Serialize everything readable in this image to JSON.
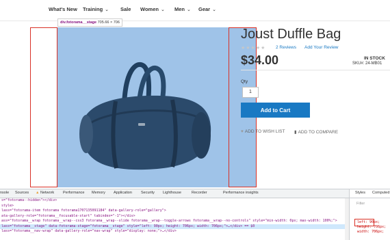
{
  "nav": {
    "items": [
      {
        "label": "What's New",
        "has_dropdown": false
      },
      {
        "label": "Training",
        "has_dropdown": true
      },
      {
        "label": "Sale",
        "has_dropdown": false
      },
      {
        "label": "Women",
        "has_dropdown": true
      },
      {
        "label": "Men",
        "has_dropdown": true
      },
      {
        "label": "Gear",
        "has_dropdown": true
      }
    ],
    "dropdown_glyph": "⌄"
  },
  "tooltip": {
    "selector": "div.fotorama__stage",
    "size": "705.66 × 706"
  },
  "product": {
    "title": "Joust Duffle Bag",
    "rating_stars": "★★★★★",
    "reviews": "2 Reviews",
    "add_review": "Add Your Review",
    "price": "$34.00",
    "stock": "IN STOCK",
    "sku": "SKU#: 24-MB01",
    "qty_label": "Qty",
    "qty_value": "1",
    "add_to_cart": "Add to Cart",
    "wish_list": "ADD TO WISH LIST",
    "compare": "ADD TO COMPARE",
    "accent_color": "#1979c3"
  },
  "devtools": {
    "tabs": [
      "nsole",
      "Sources",
      "Network",
      "Performance",
      "Memory",
      "Application",
      "Security",
      "Lighthouse",
      "Recorder",
      "Performance insights"
    ],
    "code_lines": [
      "s=\"fotorama--hidden\"></div>",
      "style>",
      "lass=\"fotorama-item fotorama fotorama1707135091184\" data-gallery-role=\"gallery\">",
      "ata-gallery-role=\"fotorama__focusable-start\" tabindex=\"-1\"></div>",
      "ass=\"fotorama__wrap fotorama__wrap--css3 fotorama__wrap--slide fotorama__wrap--toggle-arrows fotorama__wrap--no-controls\" style=\"min-width: 0px; max-width: 100%;\">",
      "lass=\"fotorama__stage\" data-fotorama-stage=\"fotorama__stage\" style=\"left: 90px; height: 706px; width: 706px;\">…</div> == $0",
      "lass=\"fotorama__nav-wrap\" data-gallery-role=\"nav-wrap\" style=\"display: none;\">…</div>"
    ],
    "styles_tabs": [
      "Styles",
      "Computed"
    ],
    "filter_placeholder": "Filter",
    "props": [
      "left: 90px;",
      "height: 706px;",
      "width: 706px;"
    ],
    "selection_color": "#cfe8fc"
  }
}
